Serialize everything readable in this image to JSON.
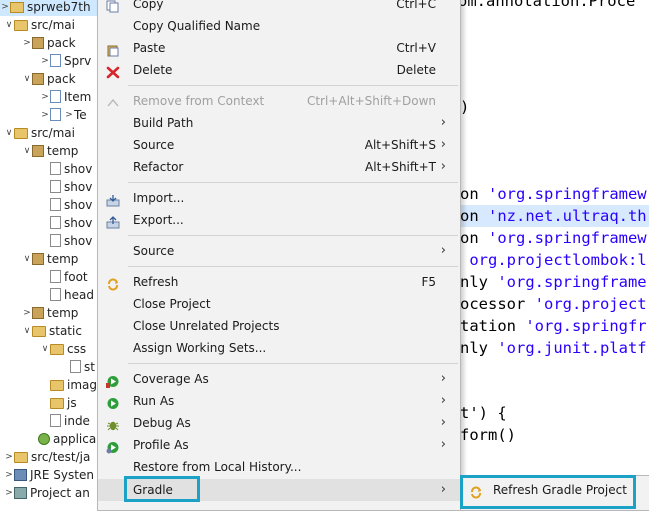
{
  "editor": {
    "lines": [
      {
        "pre": "",
        "str": "",
        "post": "om.annotation.Proce"
      },
      {
        "pre": ")",
        "str": "",
        "post": ""
      },
      {
        "pre": "on ",
        "str": "'org.springframew",
        "post": ""
      },
      {
        "pre": "on ",
        "str": "'nz.net.ultraq.th",
        "post": ""
      },
      {
        "pre": "on ",
        "str": "'org.springframew",
        "post": ""
      },
      {
        "pre": " ",
        "str": "org.projectlombok:l",
        "post": ""
      },
      {
        "pre": "nly ",
        "str": "'org.springframe",
        "post": ""
      },
      {
        "pre": "ocessor ",
        "str": "'org.project",
        "post": ""
      },
      {
        "pre": "tation ",
        "str": "'org.springfr",
        "post": ""
      },
      {
        "pre": "nly ",
        "str": "'org.junit.platf",
        "post": ""
      },
      {
        "pre": "t') {",
        "str": "",
        "post": ""
      },
      {
        "pre": "form()",
        "str": "",
        "post": ""
      }
    ]
  },
  "tree": {
    "rows": [
      {
        "label": "sprweb7th",
        "toggle": ">"
      },
      {
        "label": "src/mai",
        "toggle": "∨"
      },
      {
        "label": "pack",
        "toggle": ">"
      },
      {
        "label": "Sprv",
        "toggle": ">"
      },
      {
        "label": "pack",
        "toggle": "∨"
      },
      {
        "label": "Item",
        "toggle": ">"
      },
      {
        "label": "Te",
        "toggle": ">"
      },
      {
        "label": "src/mai",
        "toggle": "∨"
      },
      {
        "label": "temp",
        "toggle": "∨"
      },
      {
        "label": "shov",
        "toggle": ""
      },
      {
        "label": "shov",
        "toggle": ""
      },
      {
        "label": "shov",
        "toggle": ""
      },
      {
        "label": "shov",
        "toggle": ""
      },
      {
        "label": "shov",
        "toggle": ""
      },
      {
        "label": "temp",
        "toggle": "∨"
      },
      {
        "label": "foot",
        "toggle": ""
      },
      {
        "label": "head",
        "toggle": ""
      },
      {
        "label": "temp",
        "toggle": ">"
      },
      {
        "label": "static",
        "toggle": "∨"
      },
      {
        "label": "css",
        "toggle": "∨"
      },
      {
        "label": "st",
        "toggle": ""
      },
      {
        "label": "imag",
        "toggle": ""
      },
      {
        "label": "js",
        "toggle": ""
      },
      {
        "label": "inde",
        "toggle": ""
      },
      {
        "label": "applica",
        "toggle": ""
      },
      {
        "label": "src/test/ja",
        "toggle": ">"
      },
      {
        "label": "JRE Systen",
        "toggle": ">"
      },
      {
        "label": "Project an",
        "toggle": ">"
      }
    ]
  },
  "menu": {
    "items": [
      {
        "label": "Copy",
        "shortcut": "Ctrl+C",
        "icon": "copy-icon"
      },
      {
        "label": "Copy Qualified Name",
        "shortcut": "",
        "icon": ""
      },
      {
        "label": "Paste",
        "shortcut": "Ctrl+V",
        "icon": "paste-icon"
      },
      {
        "label": "Delete",
        "shortcut": "Delete",
        "icon": "delete-icon"
      },
      {
        "label": "Remove from Context",
        "shortcut": "Ctrl+Alt+Shift+Down",
        "icon": "remove-context-icon"
      },
      {
        "label": "Build Path",
        "shortcut": "",
        "icon": ""
      },
      {
        "label": "Source",
        "shortcut": "Alt+Shift+S",
        "icon": ""
      },
      {
        "label": "Refactor",
        "shortcut": "Alt+Shift+T",
        "icon": ""
      },
      {
        "label": "Import...",
        "shortcut": "",
        "icon": "import-icon"
      },
      {
        "label": "Export...",
        "shortcut": "",
        "icon": "export-icon"
      },
      {
        "label": "Source",
        "shortcut": "",
        "icon": ""
      },
      {
        "label": "Refresh",
        "shortcut": "F5",
        "icon": "refresh-icon"
      },
      {
        "label": "Close Project",
        "shortcut": "",
        "icon": ""
      },
      {
        "label": "Close Unrelated Projects",
        "shortcut": "",
        "icon": ""
      },
      {
        "label": "Assign Working Sets...",
        "shortcut": "",
        "icon": ""
      },
      {
        "label": "Coverage As",
        "shortcut": "",
        "icon": "coverage-icon"
      },
      {
        "label": "Run As",
        "shortcut": "",
        "icon": "run-icon"
      },
      {
        "label": "Debug As",
        "shortcut": "",
        "icon": "debug-icon"
      },
      {
        "label": "Profile As",
        "shortcut": "",
        "icon": "profile-icon"
      },
      {
        "label": "Restore from Local History...",
        "shortcut": "",
        "icon": ""
      },
      {
        "label": "Gradle",
        "shortcut": "",
        "icon": ""
      }
    ]
  },
  "submenu": {
    "item": {
      "label": "Refresh Gradle Project",
      "icon": "gradle-refresh-icon"
    }
  },
  "colors": {
    "highlight_box": "#1ca2c6",
    "string_literal": "#2a00ff",
    "menu_bg": "#f2f2f2"
  }
}
